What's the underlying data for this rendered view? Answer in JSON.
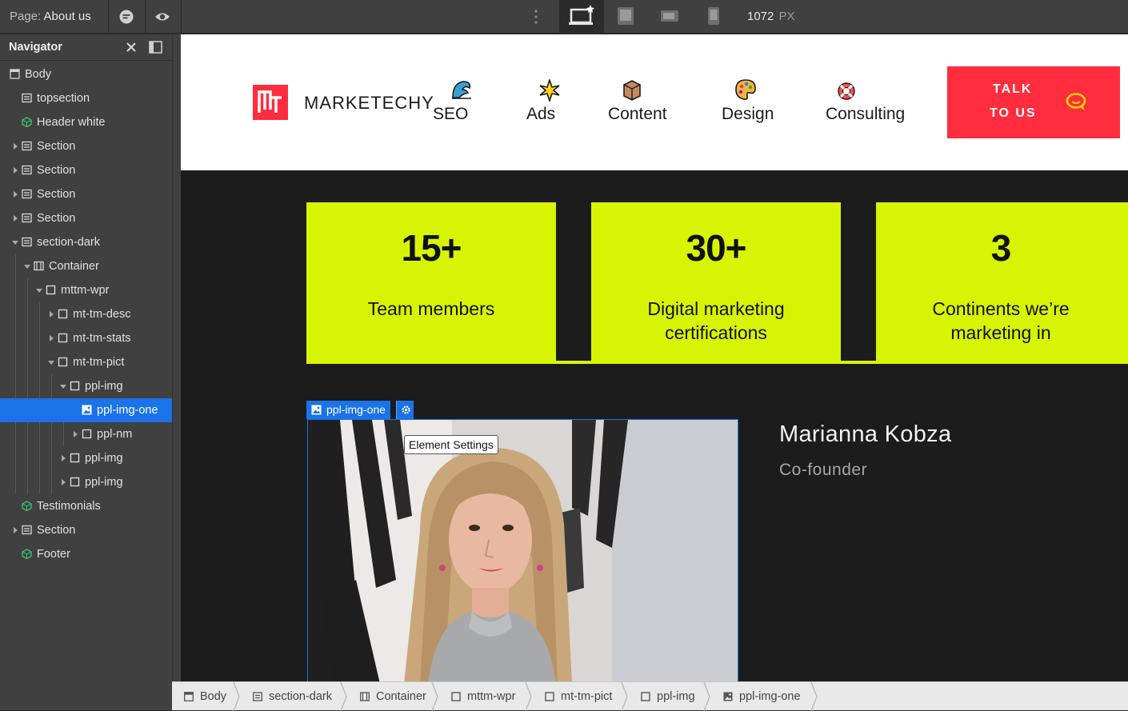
{
  "topbar": {
    "page_prefix": "Page:",
    "page_name": "About us",
    "comments_icon": "comment-icon",
    "preview_icon": "eye-icon",
    "devices": [
      "desktop-starred-icon",
      "tablet-icon",
      "mobile-landscape-icon",
      "mobile-portrait-icon"
    ],
    "active_device": "desktop-starred-icon",
    "width_value": "1072",
    "width_unit": "PX"
  },
  "navigator": {
    "title": "Navigator",
    "items": [
      {
        "label": "Body",
        "icon": "body-icon"
      },
      {
        "label": "topsection",
        "icon": "section-icon"
      },
      {
        "label": "Header white",
        "icon": "component-icon"
      },
      {
        "label": "Section",
        "icon": "section-icon"
      },
      {
        "label": "Section",
        "icon": "section-icon"
      },
      {
        "label": "Section",
        "icon": "section-icon"
      },
      {
        "label": "Section",
        "icon": "section-icon"
      },
      {
        "label": "section-dark",
        "icon": "section-icon"
      },
      {
        "label": "Container",
        "icon": "container-icon"
      },
      {
        "label": "mttm-wpr",
        "icon": "div-icon"
      },
      {
        "label": "mt-tm-desc",
        "icon": "div-icon"
      },
      {
        "label": "mt-tm-stats",
        "icon": "div-icon"
      },
      {
        "label": "mt-tm-pict",
        "icon": "div-icon"
      },
      {
        "label": "ppl-img",
        "icon": "div-icon"
      },
      {
        "label": "ppl-img-one",
        "icon": "image-icon"
      },
      {
        "label": "ppl-nm",
        "icon": "div-icon"
      },
      {
        "label": "ppl-img",
        "icon": "div-icon"
      },
      {
        "label": "ppl-img",
        "icon": "div-icon"
      },
      {
        "label": "Testimonials",
        "icon": "component-icon"
      },
      {
        "label": "Section",
        "icon": "section-icon"
      },
      {
        "label": "Footer",
        "icon": "component-icon"
      }
    ],
    "selected": "ppl-img-one"
  },
  "site": {
    "logo_text": "MARKETECHY",
    "menu": [
      {
        "label": "SEO",
        "icon": "wave-icon"
      },
      {
        "label": "Ads",
        "icon": "sparkle-icon"
      },
      {
        "label": "Content",
        "icon": "package-icon"
      },
      {
        "label": "Design",
        "icon": "palette-icon"
      },
      {
        "label": "Consulting",
        "icon": "lifebuoy-icon"
      }
    ],
    "cta_line1": "TALK",
    "cta_line2": "TO US",
    "brand_color": "#ff2d3d",
    "accent_color": "#d7f503",
    "stats": [
      {
        "number": "15+",
        "label_l1": "Team members",
        "label_l2": ""
      },
      {
        "number": "30+",
        "label_l1": "Digital marketing",
        "label_l2": "certifications"
      },
      {
        "number": "3",
        "label_l1": "Continents we’re",
        "label_l2": "marketing in"
      }
    ],
    "selected_element": "ppl-img-one",
    "tooltip": "Element Settings",
    "person_name": "Marianna Kobza",
    "person_role": "Co-founder"
  },
  "breadcrumb": [
    "Body",
    "section-dark",
    "Container",
    "mttm-wpr",
    "mt-tm-pict",
    "ppl-img",
    "ppl-img-one"
  ],
  "selection_color": "#1a73e8"
}
